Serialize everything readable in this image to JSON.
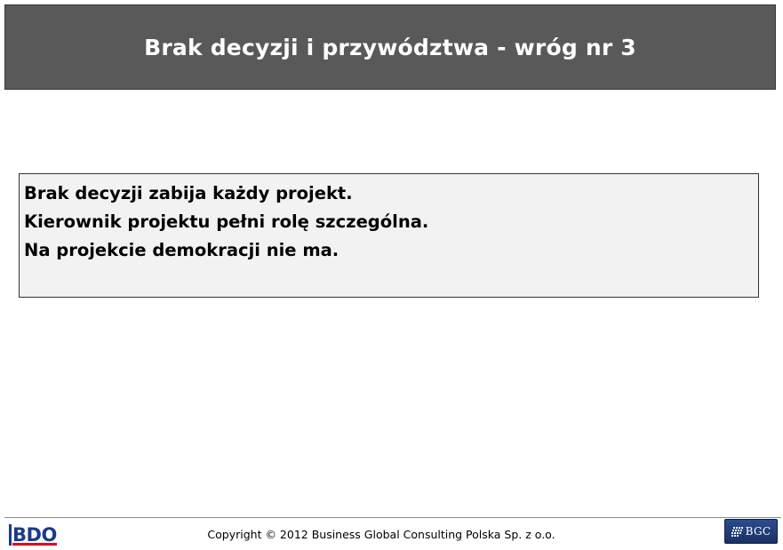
{
  "slide": {
    "title": "Brak decyzji i przywództwa - wróg nr 3",
    "content_lines": [
      "Brak decyzji zabija każdy projekt.",
      "Kierownik projektu pełni rolę szczególna.",
      "Na projekcie demokracji nie ma."
    ]
  },
  "footer": {
    "left_logo_text": "BDO",
    "copyright": "Copyright © 2012 Business Global Consulting Polska Sp. z o.o.",
    "right_logo_text": "BGC"
  },
  "colors": {
    "title_bg": "#595959",
    "title_text": "#ffffff",
    "content_bg": "#f2f2f2",
    "bdo_blue": "#1a3a8a",
    "bdo_red": "#e3001b",
    "bgc_blue": "#2b4c8f"
  }
}
